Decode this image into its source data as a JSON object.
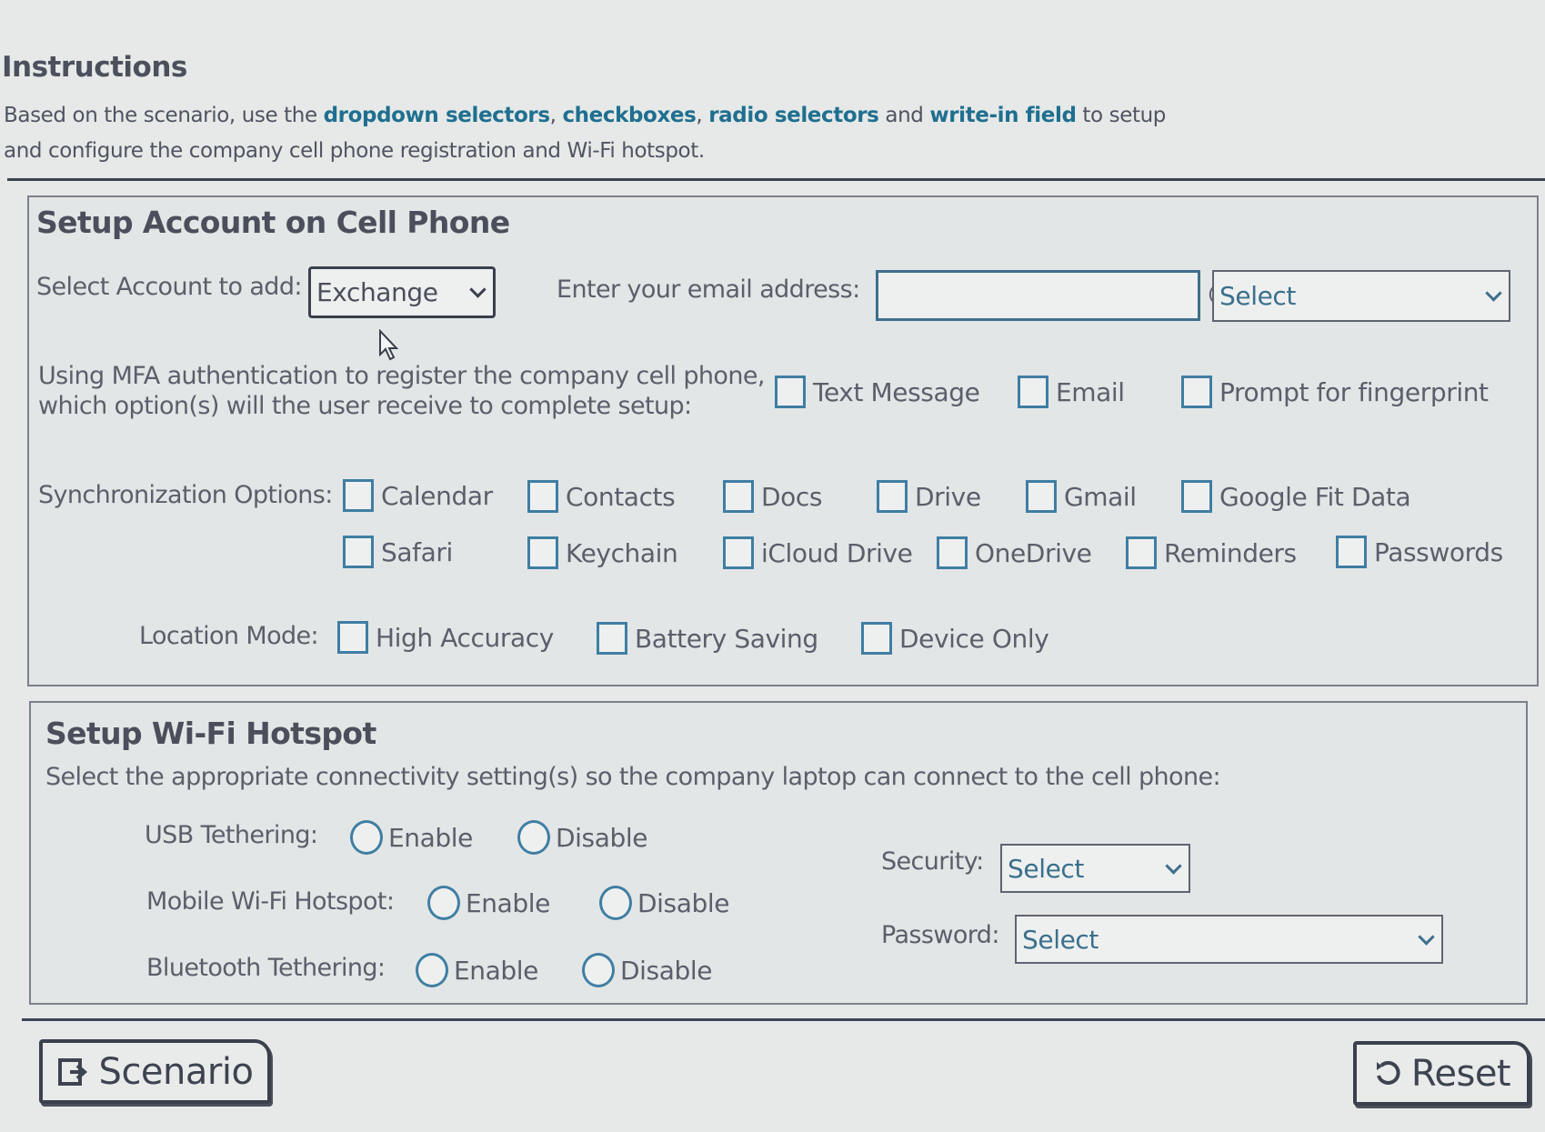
{
  "instructions": {
    "title": "Instructions",
    "text_parts": [
      "Based on the scenario, use the ",
      "dropdown selectors",
      ", ",
      "checkboxes",
      ", ",
      "radio selectors",
      " and ",
      "write-in field",
      " to setup and configure the company cell phone registration and Wi-Fi hotspot."
    ]
  },
  "account_section": {
    "title": "Setup Account on Cell Phone",
    "account_label": "Select Account to add:",
    "account_selected": "Exchange",
    "email_label": "Enter your email address:",
    "email_value": "",
    "at_symbol": "@",
    "domain_selected": "Select",
    "mfa_question_line1": "Using MFA authentication to register the company cell phone,",
    "mfa_question_line2": "which option(s) will the user receive to complete setup:",
    "mfa_options": [
      {
        "label": "Text Message",
        "checked": false
      },
      {
        "label": "Email",
        "checked": false
      },
      {
        "label": "Prompt for fingerprint",
        "checked": false
      }
    ],
    "sync_label": "Synchronization Options:",
    "sync_options": [
      {
        "label": "Calendar",
        "checked": false
      },
      {
        "label": "Contacts",
        "checked": false
      },
      {
        "label": "Docs",
        "checked": false
      },
      {
        "label": "Drive",
        "checked": false
      },
      {
        "label": "Gmail",
        "checked": false
      },
      {
        "label": "Google Fit Data",
        "checked": false
      },
      {
        "label": "Safari",
        "checked": false
      },
      {
        "label": "Keychain",
        "checked": false
      },
      {
        "label": "iCloud Drive",
        "checked": false
      },
      {
        "label": "OneDrive",
        "checked": false
      },
      {
        "label": "Reminders",
        "checked": false
      },
      {
        "label": "Passwords",
        "checked": false
      }
    ],
    "location_label": "Location Mode:",
    "location_options": [
      {
        "label": "High Accuracy",
        "checked": false
      },
      {
        "label": "Battery Saving",
        "checked": false
      },
      {
        "label": "Device Only",
        "checked": false
      }
    ]
  },
  "hotspot_section": {
    "title": "Setup Wi-Fi Hotspot",
    "description": "Select the appropriate connectivity setting(s) so the company laptop can connect to the cell phone:",
    "rows": [
      {
        "label": "USB Tethering:",
        "enable": "Enable",
        "disable": "Disable",
        "selected": null
      },
      {
        "label": "Mobile Wi-Fi Hotspot:",
        "enable": "Enable",
        "disable": "Disable",
        "selected": null
      },
      {
        "label": "Bluetooth Tethering:",
        "enable": "Enable",
        "disable": "Disable",
        "selected": null
      }
    ],
    "security_label": "Security:",
    "security_selected": "Select",
    "password_label": "Password:",
    "password_selected": "Select"
  },
  "footer": {
    "scenario_button": "Scenario",
    "reset_button": "Reset"
  },
  "icons": {
    "scenario": "open-external-icon",
    "reset": "reset-arrow-icon",
    "cursor": "mouse-pointer-icon"
  },
  "colors": {
    "keyword": "#1f6f8f",
    "control_border": "#3f7ea3",
    "background": "#e6e9e8"
  }
}
